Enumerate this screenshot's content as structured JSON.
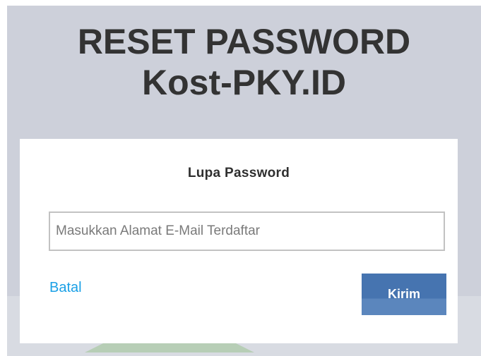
{
  "header": {
    "title_line1": "RESET PASSWORD",
    "title_line2": "Kost-PKY.ID"
  },
  "form": {
    "title": "Lupa Password",
    "email_placeholder": "Masukkan Alamat E-Mail Terdaftar",
    "email_value": "",
    "cancel_label": "Batal",
    "submit_label": "Kirim"
  },
  "colors": {
    "background": "#cdd0da",
    "card": "#ffffff",
    "link": "#1aa0e6",
    "button": "#4674b0"
  }
}
